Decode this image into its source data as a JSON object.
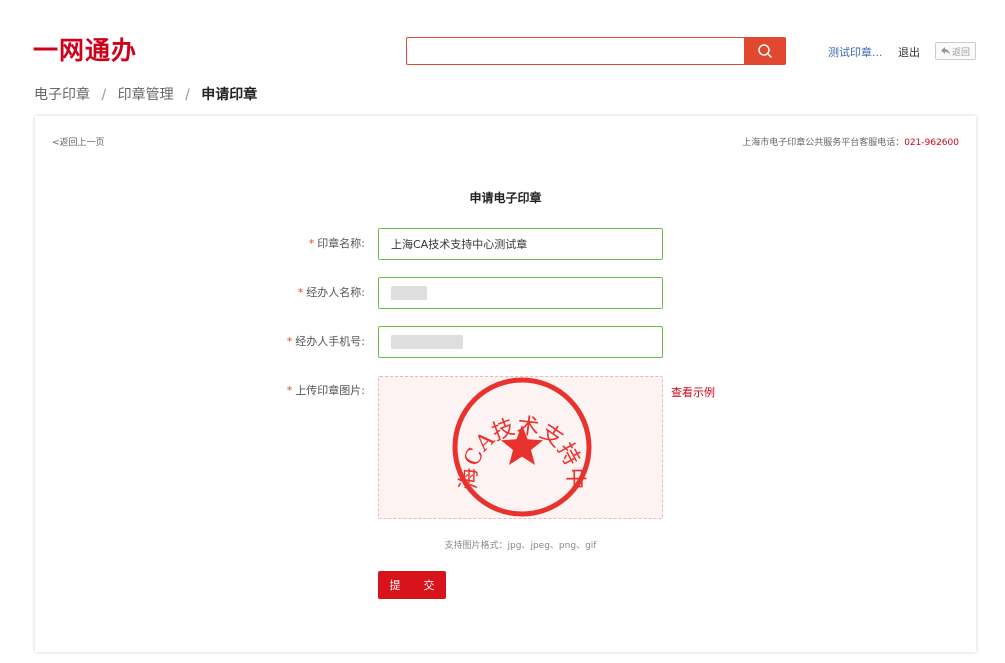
{
  "header": {
    "logo": "一网通办",
    "search": {
      "value": "",
      "placeholder": ""
    },
    "user_name": "测试印章...",
    "logout": "退出",
    "back": "返回"
  },
  "breadcrumb": [
    "电子印章",
    "印章管理",
    "申请印章"
  ],
  "card": {
    "back_link": "<返回上一页",
    "hotline_label": "上海市电子印章公共服务平台客服电话：",
    "hotline_number": "021-962600",
    "title": "申请电子印章",
    "fields": {
      "seal_name": {
        "label": "印章名称:",
        "value": "上海CA技术支持中心测试章"
      },
      "handler_name": {
        "label": "经办人名称:",
        "value": ""
      },
      "handler_phone": {
        "label": "经办人手机号:",
        "value": ""
      },
      "seal_image": {
        "label": "上传印章图片:"
      }
    },
    "required_mark": "*",
    "seal_text": "上海CA技术支持中心",
    "example_link": "查看示例",
    "format_hint": "支持图片格式：jpg、jpeg、png、gif",
    "submit": "提 交"
  },
  "colors": {
    "brand": "#d0021b",
    "search": "#e2482f",
    "valid_border": "#6cc04a",
    "seal": "#e8322e"
  },
  "icons": {
    "search": "search-icon",
    "back": "reply-arrow-icon",
    "seal_star": "star-icon"
  }
}
